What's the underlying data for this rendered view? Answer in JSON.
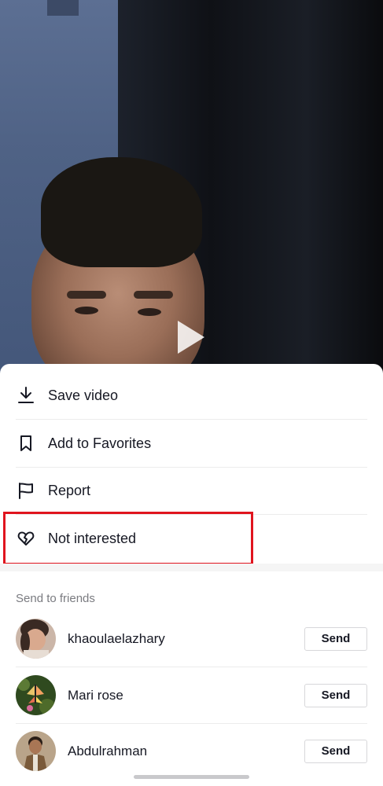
{
  "menu": {
    "items": [
      {
        "label": "Save video",
        "icon": "download-icon"
      },
      {
        "label": "Add to Favorites",
        "icon": "bookmark-icon"
      },
      {
        "label": "Report",
        "icon": "flag-icon"
      },
      {
        "label": "Not interested",
        "icon": "broken-heart-icon"
      }
    ]
  },
  "send_section": {
    "title": "Send to friends",
    "friends": [
      {
        "name": "khaoulaelazhary",
        "button": "Send"
      },
      {
        "name": "Mari rose",
        "button": "Send"
      },
      {
        "name": "Abdulrahman",
        "button": "Send"
      }
    ]
  },
  "colors": {
    "highlight": "#e0141e",
    "text_primary": "#161823",
    "text_secondary": "#7a7b80"
  }
}
